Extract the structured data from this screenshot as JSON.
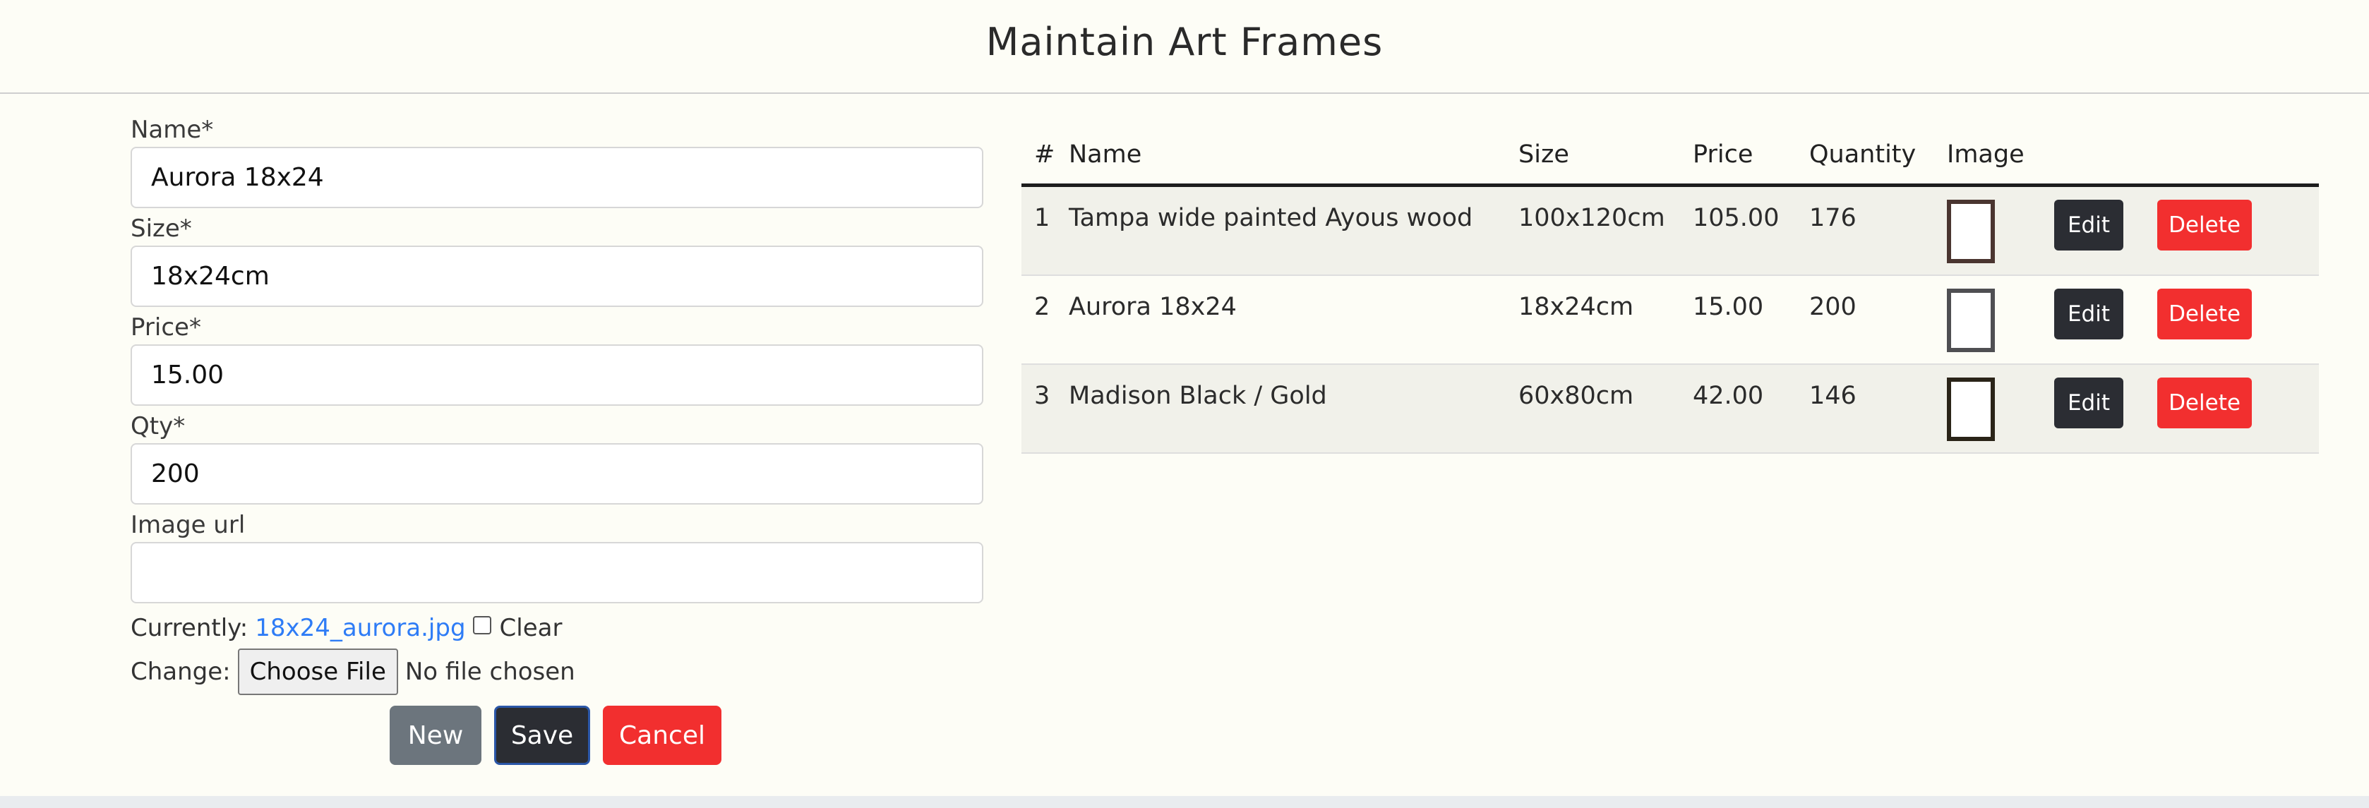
{
  "page": {
    "title": "Maintain Art Frames"
  },
  "form": {
    "name_label": "Name*",
    "name_value": "Aurora 18x24",
    "size_label": "Size*",
    "size_value": "18x24cm",
    "price_label": "Price*",
    "price_value": "15.00",
    "qty_label": "Qty*",
    "qty_value": "200",
    "image_url_label": "Image url",
    "image_url_value": "",
    "currently_label": "Currently:",
    "current_file": "18x24_aurora.jpg",
    "clear_label": "Clear",
    "change_label": "Change:",
    "choose_file_label": "Choose File",
    "no_file_text": "No file chosen",
    "buttons": {
      "new": "New",
      "save": "Save",
      "cancel": "Cancel"
    }
  },
  "table": {
    "headers": {
      "num": "#",
      "name": "Name",
      "size": "Size",
      "price": "Price",
      "quantity": "Quantity",
      "image": "Image"
    },
    "rows": [
      {
        "num": "1",
        "name": "Tampa wide painted Ayous wood",
        "size": "100x120cm",
        "price": "105.00",
        "quantity": "176",
        "frame_color": "#4a3530",
        "edit": "Edit",
        "delete": "Delete"
      },
      {
        "num": "2",
        "name": "Aurora 18x24",
        "size": "18x24cm",
        "price": "15.00",
        "quantity": "200",
        "frame_color": "#4f4f52",
        "edit": "Edit",
        "delete": "Delete"
      },
      {
        "num": "3",
        "name": "Madison Black / Gold",
        "size": "60x80cm",
        "price": "42.00",
        "quantity": "146",
        "frame_color": "#2a2418",
        "edit": "Edit",
        "delete": "Delete"
      }
    ]
  },
  "colors": {
    "background": "#fdfdf6",
    "danger": "#f22f2f",
    "dark": "#2b2d33",
    "secondary": "#6c757d",
    "link": "#2e7cf6"
  }
}
